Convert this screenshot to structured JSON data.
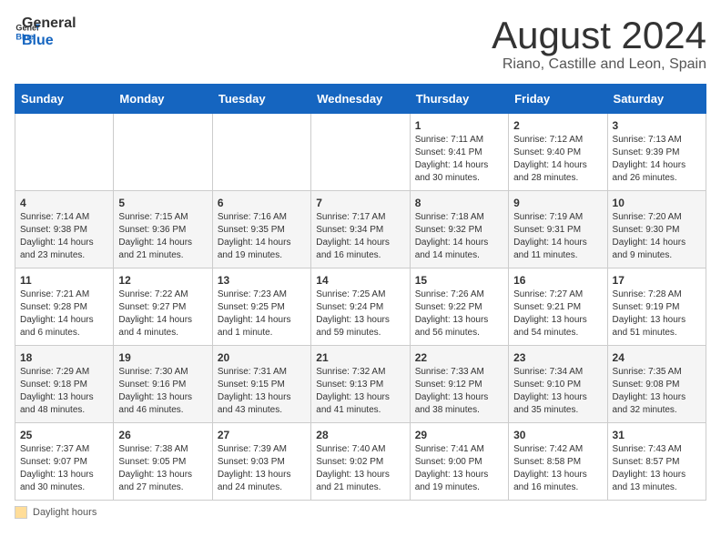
{
  "logo": {
    "text_general": "General",
    "text_blue": "Blue"
  },
  "title": "August 2024",
  "subtitle": "Riano, Castille and Leon, Spain",
  "days_header": [
    "Sunday",
    "Monday",
    "Tuesday",
    "Wednesday",
    "Thursday",
    "Friday",
    "Saturday"
  ],
  "footer": {
    "daylight_label": "Daylight hours"
  },
  "weeks": [
    [
      {
        "day": "",
        "sunrise": "",
        "sunset": "",
        "daylight": ""
      },
      {
        "day": "",
        "sunrise": "",
        "sunset": "",
        "daylight": ""
      },
      {
        "day": "",
        "sunrise": "",
        "sunset": "",
        "daylight": ""
      },
      {
        "day": "",
        "sunrise": "",
        "sunset": "",
        "daylight": ""
      },
      {
        "day": "1",
        "sunrise": "Sunrise: 7:11 AM",
        "sunset": "Sunset: 9:41 PM",
        "daylight": "Daylight: 14 hours and 30 minutes."
      },
      {
        "day": "2",
        "sunrise": "Sunrise: 7:12 AM",
        "sunset": "Sunset: 9:40 PM",
        "daylight": "Daylight: 14 hours and 28 minutes."
      },
      {
        "day": "3",
        "sunrise": "Sunrise: 7:13 AM",
        "sunset": "Sunset: 9:39 PM",
        "daylight": "Daylight: 14 hours and 26 minutes."
      }
    ],
    [
      {
        "day": "4",
        "sunrise": "Sunrise: 7:14 AM",
        "sunset": "Sunset: 9:38 PM",
        "daylight": "Daylight: 14 hours and 23 minutes."
      },
      {
        "day": "5",
        "sunrise": "Sunrise: 7:15 AM",
        "sunset": "Sunset: 9:36 PM",
        "daylight": "Daylight: 14 hours and 21 minutes."
      },
      {
        "day": "6",
        "sunrise": "Sunrise: 7:16 AM",
        "sunset": "Sunset: 9:35 PM",
        "daylight": "Daylight: 14 hours and 19 minutes."
      },
      {
        "day": "7",
        "sunrise": "Sunrise: 7:17 AM",
        "sunset": "Sunset: 9:34 PM",
        "daylight": "Daylight: 14 hours and 16 minutes."
      },
      {
        "day": "8",
        "sunrise": "Sunrise: 7:18 AM",
        "sunset": "Sunset: 9:32 PM",
        "daylight": "Daylight: 14 hours and 14 minutes."
      },
      {
        "day": "9",
        "sunrise": "Sunrise: 7:19 AM",
        "sunset": "Sunset: 9:31 PM",
        "daylight": "Daylight: 14 hours and 11 minutes."
      },
      {
        "day": "10",
        "sunrise": "Sunrise: 7:20 AM",
        "sunset": "Sunset: 9:30 PM",
        "daylight": "Daylight: 14 hours and 9 minutes."
      }
    ],
    [
      {
        "day": "11",
        "sunrise": "Sunrise: 7:21 AM",
        "sunset": "Sunset: 9:28 PM",
        "daylight": "Daylight: 14 hours and 6 minutes."
      },
      {
        "day": "12",
        "sunrise": "Sunrise: 7:22 AM",
        "sunset": "Sunset: 9:27 PM",
        "daylight": "Daylight: 14 hours and 4 minutes."
      },
      {
        "day": "13",
        "sunrise": "Sunrise: 7:23 AM",
        "sunset": "Sunset: 9:25 PM",
        "daylight": "Daylight: 14 hours and 1 minute."
      },
      {
        "day": "14",
        "sunrise": "Sunrise: 7:25 AM",
        "sunset": "Sunset: 9:24 PM",
        "daylight": "Daylight: 13 hours and 59 minutes."
      },
      {
        "day": "15",
        "sunrise": "Sunrise: 7:26 AM",
        "sunset": "Sunset: 9:22 PM",
        "daylight": "Daylight: 13 hours and 56 minutes."
      },
      {
        "day": "16",
        "sunrise": "Sunrise: 7:27 AM",
        "sunset": "Sunset: 9:21 PM",
        "daylight": "Daylight: 13 hours and 54 minutes."
      },
      {
        "day": "17",
        "sunrise": "Sunrise: 7:28 AM",
        "sunset": "Sunset: 9:19 PM",
        "daylight": "Daylight: 13 hours and 51 minutes."
      }
    ],
    [
      {
        "day": "18",
        "sunrise": "Sunrise: 7:29 AM",
        "sunset": "Sunset: 9:18 PM",
        "daylight": "Daylight: 13 hours and 48 minutes."
      },
      {
        "day": "19",
        "sunrise": "Sunrise: 7:30 AM",
        "sunset": "Sunset: 9:16 PM",
        "daylight": "Daylight: 13 hours and 46 minutes."
      },
      {
        "day": "20",
        "sunrise": "Sunrise: 7:31 AM",
        "sunset": "Sunset: 9:15 PM",
        "daylight": "Daylight: 13 hours and 43 minutes."
      },
      {
        "day": "21",
        "sunrise": "Sunrise: 7:32 AM",
        "sunset": "Sunset: 9:13 PM",
        "daylight": "Daylight: 13 hours and 41 minutes."
      },
      {
        "day": "22",
        "sunrise": "Sunrise: 7:33 AM",
        "sunset": "Sunset: 9:12 PM",
        "daylight": "Daylight: 13 hours and 38 minutes."
      },
      {
        "day": "23",
        "sunrise": "Sunrise: 7:34 AM",
        "sunset": "Sunset: 9:10 PM",
        "daylight": "Daylight: 13 hours and 35 minutes."
      },
      {
        "day": "24",
        "sunrise": "Sunrise: 7:35 AM",
        "sunset": "Sunset: 9:08 PM",
        "daylight": "Daylight: 13 hours and 32 minutes."
      }
    ],
    [
      {
        "day": "25",
        "sunrise": "Sunrise: 7:37 AM",
        "sunset": "Sunset: 9:07 PM",
        "daylight": "Daylight: 13 hours and 30 minutes."
      },
      {
        "day": "26",
        "sunrise": "Sunrise: 7:38 AM",
        "sunset": "Sunset: 9:05 PM",
        "daylight": "Daylight: 13 hours and 27 minutes."
      },
      {
        "day": "27",
        "sunrise": "Sunrise: 7:39 AM",
        "sunset": "Sunset: 9:03 PM",
        "daylight": "Daylight: 13 hours and 24 minutes."
      },
      {
        "day": "28",
        "sunrise": "Sunrise: 7:40 AM",
        "sunset": "Sunset: 9:02 PM",
        "daylight": "Daylight: 13 hours and 21 minutes."
      },
      {
        "day": "29",
        "sunrise": "Sunrise: 7:41 AM",
        "sunset": "Sunset: 9:00 PM",
        "daylight": "Daylight: 13 hours and 19 minutes."
      },
      {
        "day": "30",
        "sunrise": "Sunrise: 7:42 AM",
        "sunset": "Sunset: 8:58 PM",
        "daylight": "Daylight: 13 hours and 16 minutes."
      },
      {
        "day": "31",
        "sunrise": "Sunrise: 7:43 AM",
        "sunset": "Sunset: 8:57 PM",
        "daylight": "Daylight: 13 hours and 13 minutes."
      }
    ]
  ]
}
